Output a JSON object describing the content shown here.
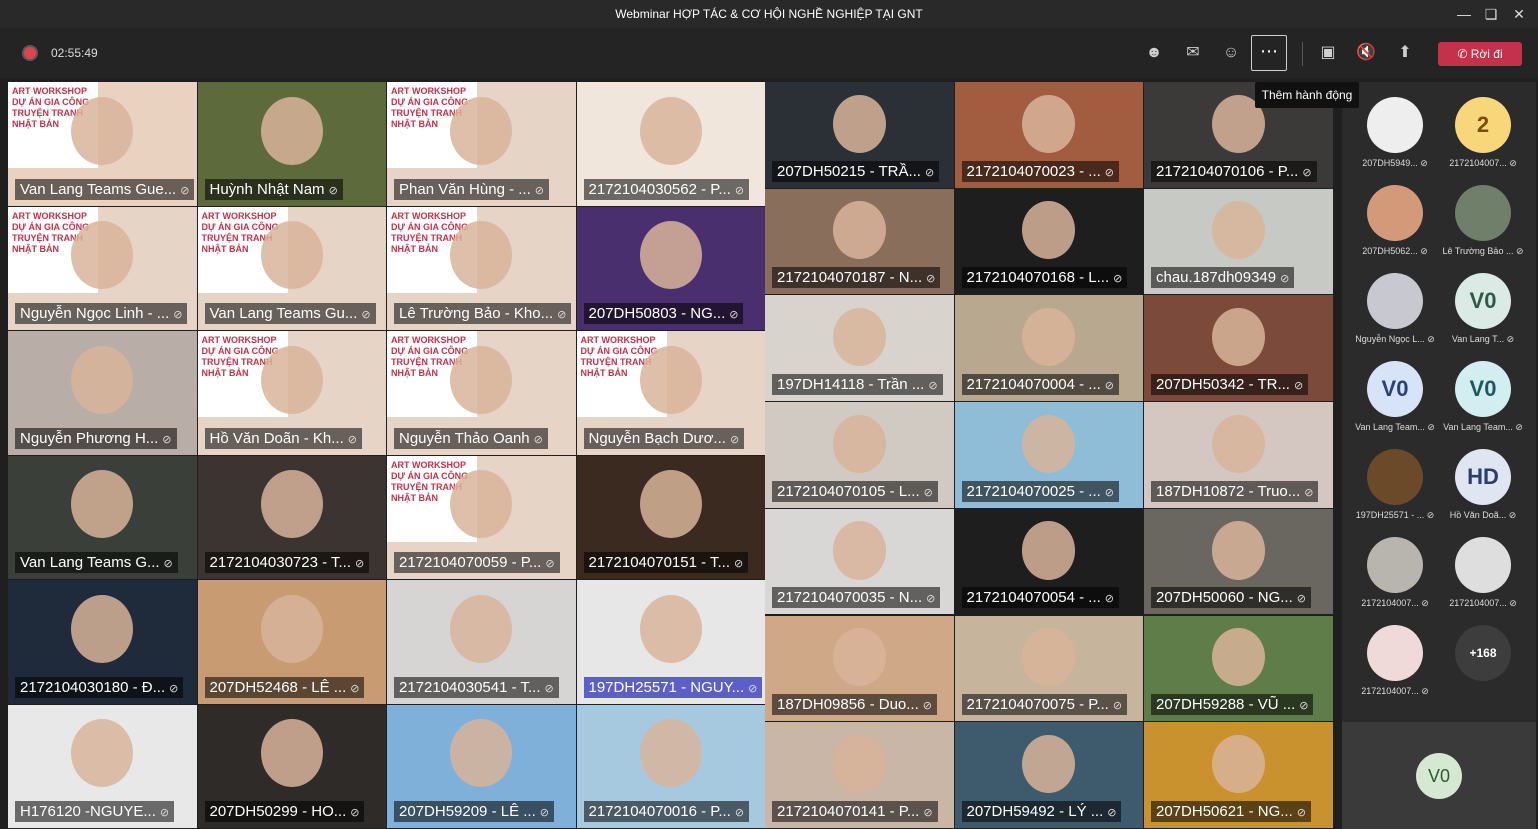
{
  "window": {
    "title": "Webminar HỢP TÁC & CƠ HỘI NGHỀ NGHIỆP TẠI GNT"
  },
  "toolbar": {
    "timer": "02:55:49",
    "leave_label": "Rời đi",
    "more_tooltip": "Thêm hành động"
  },
  "grid": {
    "tiles": [
      {
        "label": "Van Lang Teams Gue...",
        "bg": "#e9d3c0",
        "poster": true
      },
      {
        "label": "Huỳnh Nhật Nam",
        "bg": "#5d6b3c",
        "poster": false
      },
      {
        "label": "Phan Văn Hùng - ...",
        "bg": "#e6d4c7",
        "poster": true
      },
      {
        "label": "2172104030562 - P...",
        "bg": "#f0e6dc",
        "poster": false
      },
      {
        "label": "207DH50215 - TRẦ...",
        "bg": "#2b2f36",
        "poster": false
      },
      {
        "label": "2172104070023 - ...",
        "bg": "#a25c3f",
        "poster": false
      },
      {
        "label": "2172104070106 - P...",
        "bg": "#3c3a38",
        "poster": false
      },
      {
        "label": "Nguyễn Ngọc Linh - ...",
        "bg": "#e6d4c7",
        "poster": true
      },
      {
        "label": "Van Lang Teams Gu...",
        "bg": "#e6d4c7",
        "poster": true
      },
      {
        "label": "Lê Trường Bảo - Kho...",
        "bg": "#e6d4c7",
        "poster": true
      },
      {
        "label": "207DH50803 - NG...",
        "bg": "#4a2f6f",
        "poster": false
      },
      {
        "label": "2172104070187 - N...",
        "bg": "#8a6e5c",
        "poster": false
      },
      {
        "label": "2172104070168 - L...",
        "bg": "#1e1e1e",
        "poster": false
      },
      {
        "label": "chau.187dh09349",
        "bg": "#c7c9c4",
        "poster": false
      },
      {
        "label": "Nguyễn Phương H...",
        "bg": "#b9aea7",
        "poster": false
      },
      {
        "label": "Hồ Văn Doãn - Kh...",
        "bg": "#e6d4c7",
        "poster": true
      },
      {
        "label": "Nguyễn Thảo Oanh",
        "bg": "#e6d4c7",
        "poster": true
      },
      {
        "label": "Nguyễn Bạch Dươ...",
        "bg": "#e6d4c7",
        "poster": true
      },
      {
        "label": "197DH14118 - Trần ...",
        "bg": "#d8d4cd",
        "poster": false
      },
      {
        "label": "2172104070004 - ...",
        "bg": "#b7a88f",
        "poster": false
      },
      {
        "label": "207DH50342 - TR...",
        "bg": "#7c4a3a",
        "poster": false
      },
      {
        "label": "Van Lang Teams G...",
        "bg": "#3a3f3a",
        "poster": false
      },
      {
        "label": "2172104030723 - T...",
        "bg": "#3b3430",
        "poster": false
      },
      {
        "label": "2172104070059 - P...",
        "bg": "#e6d4c7",
        "poster": true
      },
      {
        "label": "2172104070151 - T...",
        "bg": "#3a2a20",
        "poster": false
      },
      {
        "label": "2172104070105 - L...",
        "bg": "#d0cac2",
        "poster": false
      },
      {
        "label": "2172104070025 - ...",
        "bg": "#8fbcd6",
        "poster": false
      },
      {
        "label": "187DH10872 - Truo...",
        "bg": "#d4c7c2",
        "poster": false
      },
      {
        "label": "2172104030180 - Đ...",
        "bg": "#1f2a3a",
        "poster": false
      },
      {
        "label": "207DH52468 - LÊ ...",
        "bg": "#c99b73",
        "poster": false
      },
      {
        "label": "2172104030541 - T...",
        "bg": "#d7d5d3",
        "poster": false
      },
      {
        "label": "197DH25571 - NGUY...",
        "bg": "#e7e7e7",
        "poster": false,
        "highlight": true
      },
      {
        "label": "2172104070035 - N...",
        "bg": "#d9d7d6",
        "poster": false
      },
      {
        "label": "2172104070054 - ...",
        "bg": "#1e1e1e",
        "poster": false
      },
      {
        "label": "207DH50060 - NG...",
        "bg": "#6a6660",
        "poster": false
      },
      {
        "label": "H176120 -NGUYE...",
        "bg": "#e8e8e8",
        "poster": false
      },
      {
        "label": "207DH50299 - HO...",
        "bg": "#2f2b28",
        "poster": false
      },
      {
        "label": "207DH59209 - LÊ ...",
        "bg": "#7fb0d9",
        "poster": false
      },
      {
        "label": "2172104070016 - P...",
        "bg": "#a7c9e0",
        "poster": false
      },
      {
        "label": "187DH09856 - Duo...",
        "bg": "#cfa987",
        "poster": false
      },
      {
        "label": "2172104070075 - P...",
        "bg": "#c7b49d",
        "poster": false
      },
      {
        "label": "207DH59288 - VŨ ...",
        "bg": "#5f7d48",
        "poster": false
      },
      {
        "label": "2172104070141 - P...",
        "bg": "#c9b6a6",
        "poster": false
      },
      {
        "label": "207DH59492 - LÝ ...",
        "bg": "#3e5b6e",
        "poster": false
      },
      {
        "label": "207DH50621 - NG...",
        "bg": "#c9922e",
        "poster": false
      }
    ],
    "poster_text": "ART WORKSHOP DỰ ÁN GIA CÔNG TRUYỆN TRANH NHẬT BẢN"
  },
  "side": {
    "people": [
      {
        "initials": "",
        "name": "207DH5949...",
        "bg": "#eeeeee",
        "fg": "#333"
      },
      {
        "initials": "2",
        "name": "2172104007...",
        "bg": "#f8d77a",
        "fg": "#7a4d00"
      },
      {
        "initials": "",
        "name": "207DH5062...",
        "bg": "#d39a7a",
        "fg": "#333"
      },
      {
        "initials": "",
        "name": "Lê Trường Bảo ...",
        "bg": "#6f7f6a",
        "fg": "#fff"
      },
      {
        "initials": "",
        "name": "Nguyễn Ngọc L...",
        "bg": "#c8c8d0",
        "fg": "#333"
      },
      {
        "initials": "V0",
        "name": "Van Lang T...",
        "bg": "#d9ebe4",
        "fg": "#2f5a4a"
      },
      {
        "initials": "V0",
        "name": "Van Lang Team...",
        "bg": "#d7e3f7",
        "fg": "#2a4370"
      },
      {
        "initials": "V0",
        "name": "Van Lang Team...",
        "bg": "#d3eef0",
        "fg": "#1f5960"
      },
      {
        "initials": "",
        "name": "197DH25571 - ...",
        "bg": "#6b4a2a",
        "fg": "#fff"
      },
      {
        "initials": "HD",
        "name": "Hồ Văn Doã...",
        "bg": "#dfe6f2",
        "fg": "#2a3e6b"
      },
      {
        "initials": "",
        "name": "2172104007...",
        "bg": "#b8b4ae",
        "fg": "#333"
      },
      {
        "initials": "",
        "name": "2172104007...",
        "bg": "#dedede",
        "fg": "#333"
      },
      {
        "initials": "",
        "name": "2172104007...",
        "bg": "#f0d9d9",
        "fg": "#333"
      },
      {
        "initials": "+168",
        "name": "",
        "bg": "#3d3d3d",
        "fg": "#fff"
      }
    ],
    "bottom_initials": "V0"
  }
}
